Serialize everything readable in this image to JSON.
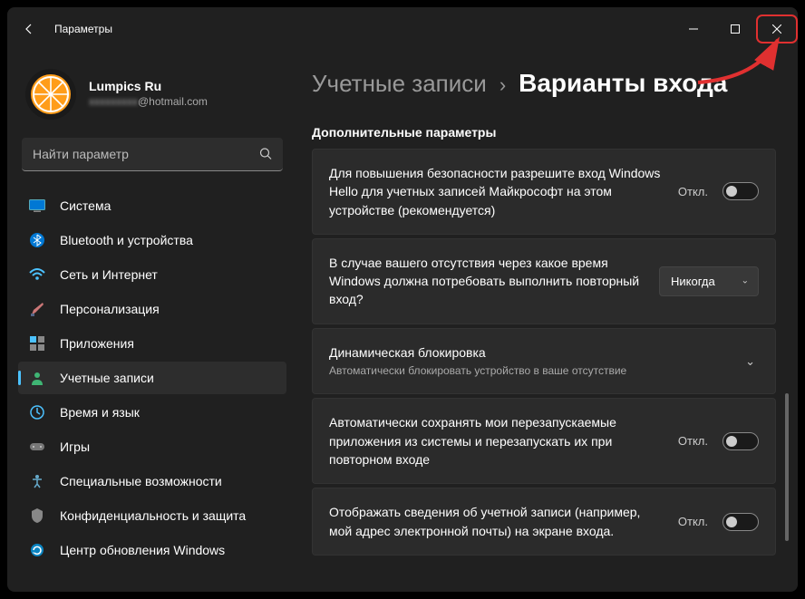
{
  "window": {
    "title": "Параметры"
  },
  "profile": {
    "name": "Lumpics Ru",
    "email_blur": "xxxxxxxxx",
    "email_suffix": "@hotmail.com"
  },
  "search": {
    "placeholder": "Найти параметр"
  },
  "nav": {
    "items": [
      {
        "label": "Система"
      },
      {
        "label": "Bluetooth и устройства"
      },
      {
        "label": "Сеть и Интернет"
      },
      {
        "label": "Персонализация"
      },
      {
        "label": "Приложения"
      },
      {
        "label": "Учетные записи"
      },
      {
        "label": "Время и язык"
      },
      {
        "label": "Игры"
      },
      {
        "label": "Специальные возможности"
      },
      {
        "label": "Конфиденциальность и защита"
      },
      {
        "label": "Центр обновления Windows"
      }
    ]
  },
  "breadcrumb": {
    "parent": "Учетные записи",
    "current": "Варианты входа"
  },
  "section": {
    "title": "Дополнительные параметры"
  },
  "cards": {
    "hello": {
      "text": "Для повышения безопасности разрешите вход Windows Hello для учетных записей Майкрософт на этом устройстве (рекомендуется)",
      "state": "Откл."
    },
    "reauth": {
      "text": "В случае вашего отсутствия через какое время Windows должна потребовать выполнить повторный вход?",
      "value": "Никогда"
    },
    "dynlock": {
      "title": "Динамическая блокировка",
      "sub": "Автоматически блокировать устройство в ваше отсутствие"
    },
    "autosave": {
      "text": "Автоматически сохранять мои перезапускаемые приложения из системы и перезапускать их при повторном входе",
      "state": "Откл."
    },
    "showinfo": {
      "text": "Отображать сведения об учетной записи (например, мой адрес электронной почты) на экране входа.",
      "state": "Откл."
    }
  }
}
